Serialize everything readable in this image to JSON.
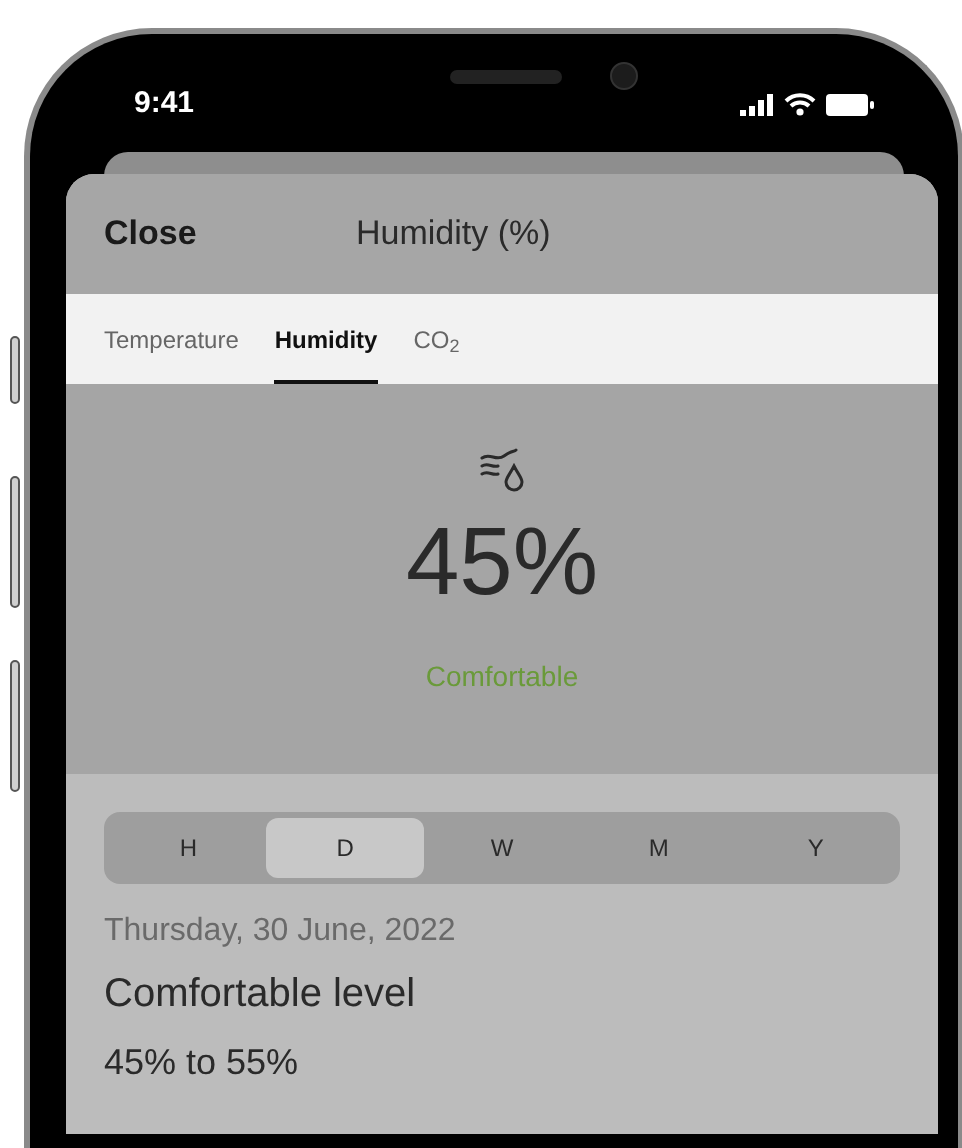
{
  "status_bar": {
    "time": "9:41"
  },
  "header": {
    "close": "Close",
    "title": "Humidity (%)"
  },
  "tabs": [
    {
      "label": "Temperature",
      "selected": false
    },
    {
      "label": "Humidity",
      "selected": true
    },
    {
      "label": "CO$_{2}$",
      "selected": false
    }
  ],
  "reading": {
    "value": "45%",
    "status": "Comfortable"
  },
  "periods": [
    {
      "label": "H",
      "selected": false
    },
    {
      "label": "D",
      "selected": true
    },
    {
      "label": "W",
      "selected": false
    },
    {
      "label": "M",
      "selected": false
    },
    {
      "label": "Y",
      "selected": false
    }
  ],
  "detail": {
    "date": "Thursday, 30 June, 2022",
    "heading": "Comfortable level",
    "range": "45% to 55%"
  }
}
